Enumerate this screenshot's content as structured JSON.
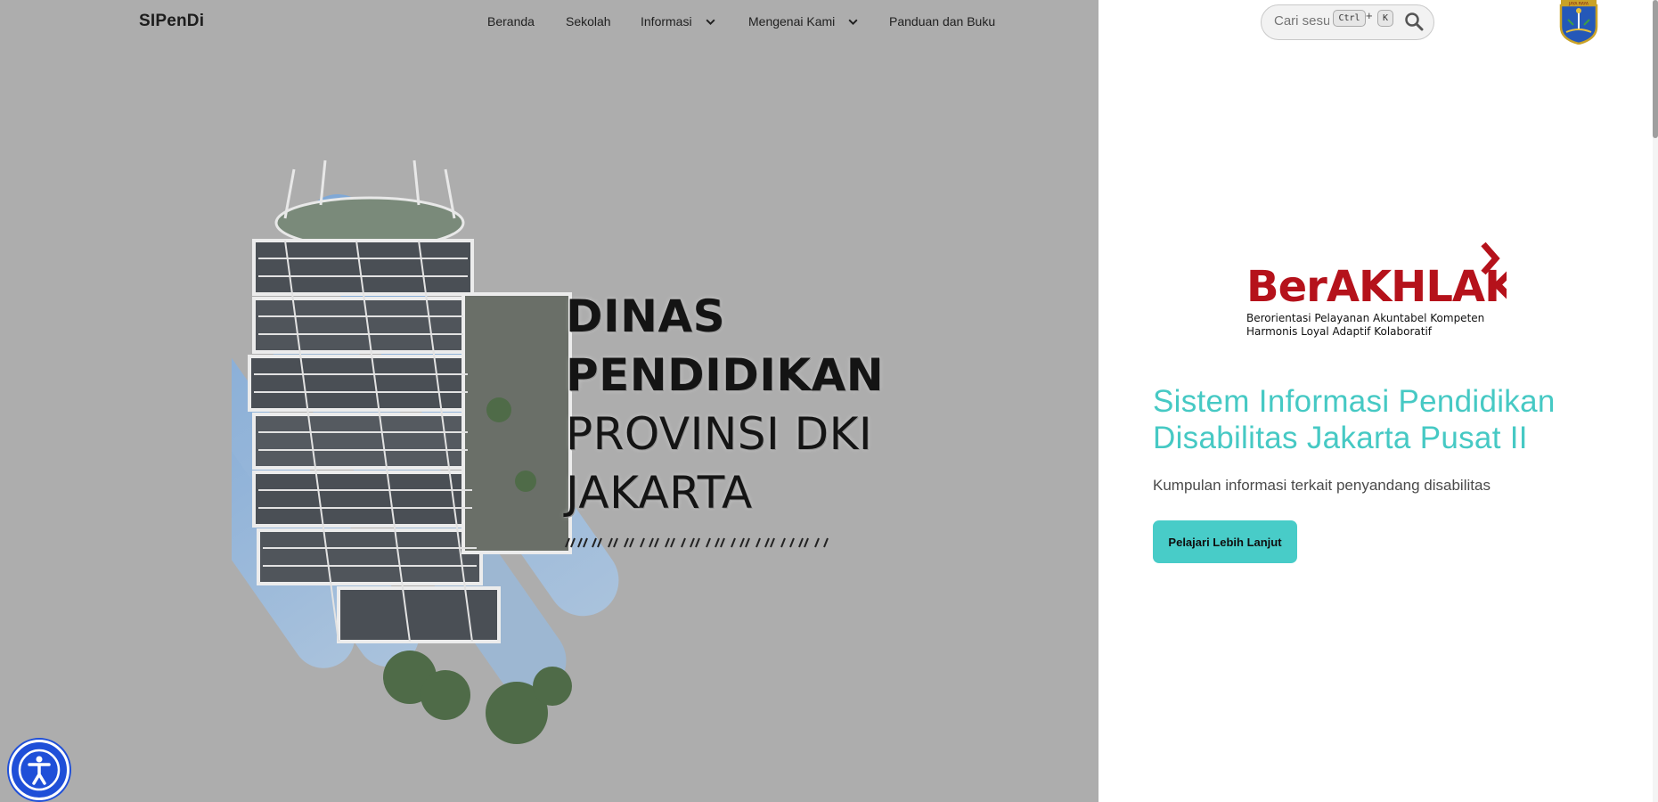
{
  "header": {
    "brand": "SIPenDi",
    "nav": [
      {
        "label": "Beranda"
      },
      {
        "label": "Sekolah"
      },
      {
        "label": "Informasi",
        "has_dropdown": true
      },
      {
        "label": "Mengenai Kami",
        "has_dropdown": true
      },
      {
        "label": "Panduan dan Buku"
      }
    ],
    "search": {
      "placeholder": "Cari sesuatu",
      "shortcut_key_1": "Ctrl",
      "shortcut_plus": "+",
      "shortcut_key_2": "K",
      "icon": "search-icon"
    },
    "crest_icon": "jakarta-crest-icon",
    "crest_text": "JAYA RAYA"
  },
  "hero_image": {
    "line1": "DINAS",
    "line2": "PENDIDIKAN",
    "line3": "PROVINSI DKI",
    "line4": "JAKARTA"
  },
  "logo": {
    "name": "BerAKHLAK",
    "tagline_line1": "Berorientasi Pelayanan Akuntabel Kompeten",
    "tagline_line2": "Harmonis Loyal Adaptif Kolaboratif"
  },
  "main": {
    "title": "Sistem Informasi Pendidikan Disabilitas Jakarta Pusat II",
    "subtitle": "Kumpulan informasi terkait penyandang disabilitas",
    "cta_label": "Pelajari Lebih Lanjut"
  },
  "colors": {
    "accent": "#46c9c4",
    "overlay": "#adadad",
    "logo_red": "#b5121b",
    "accessibility_blue": "#1f4fd8"
  },
  "accessibility_icon": "accessibility-icon"
}
